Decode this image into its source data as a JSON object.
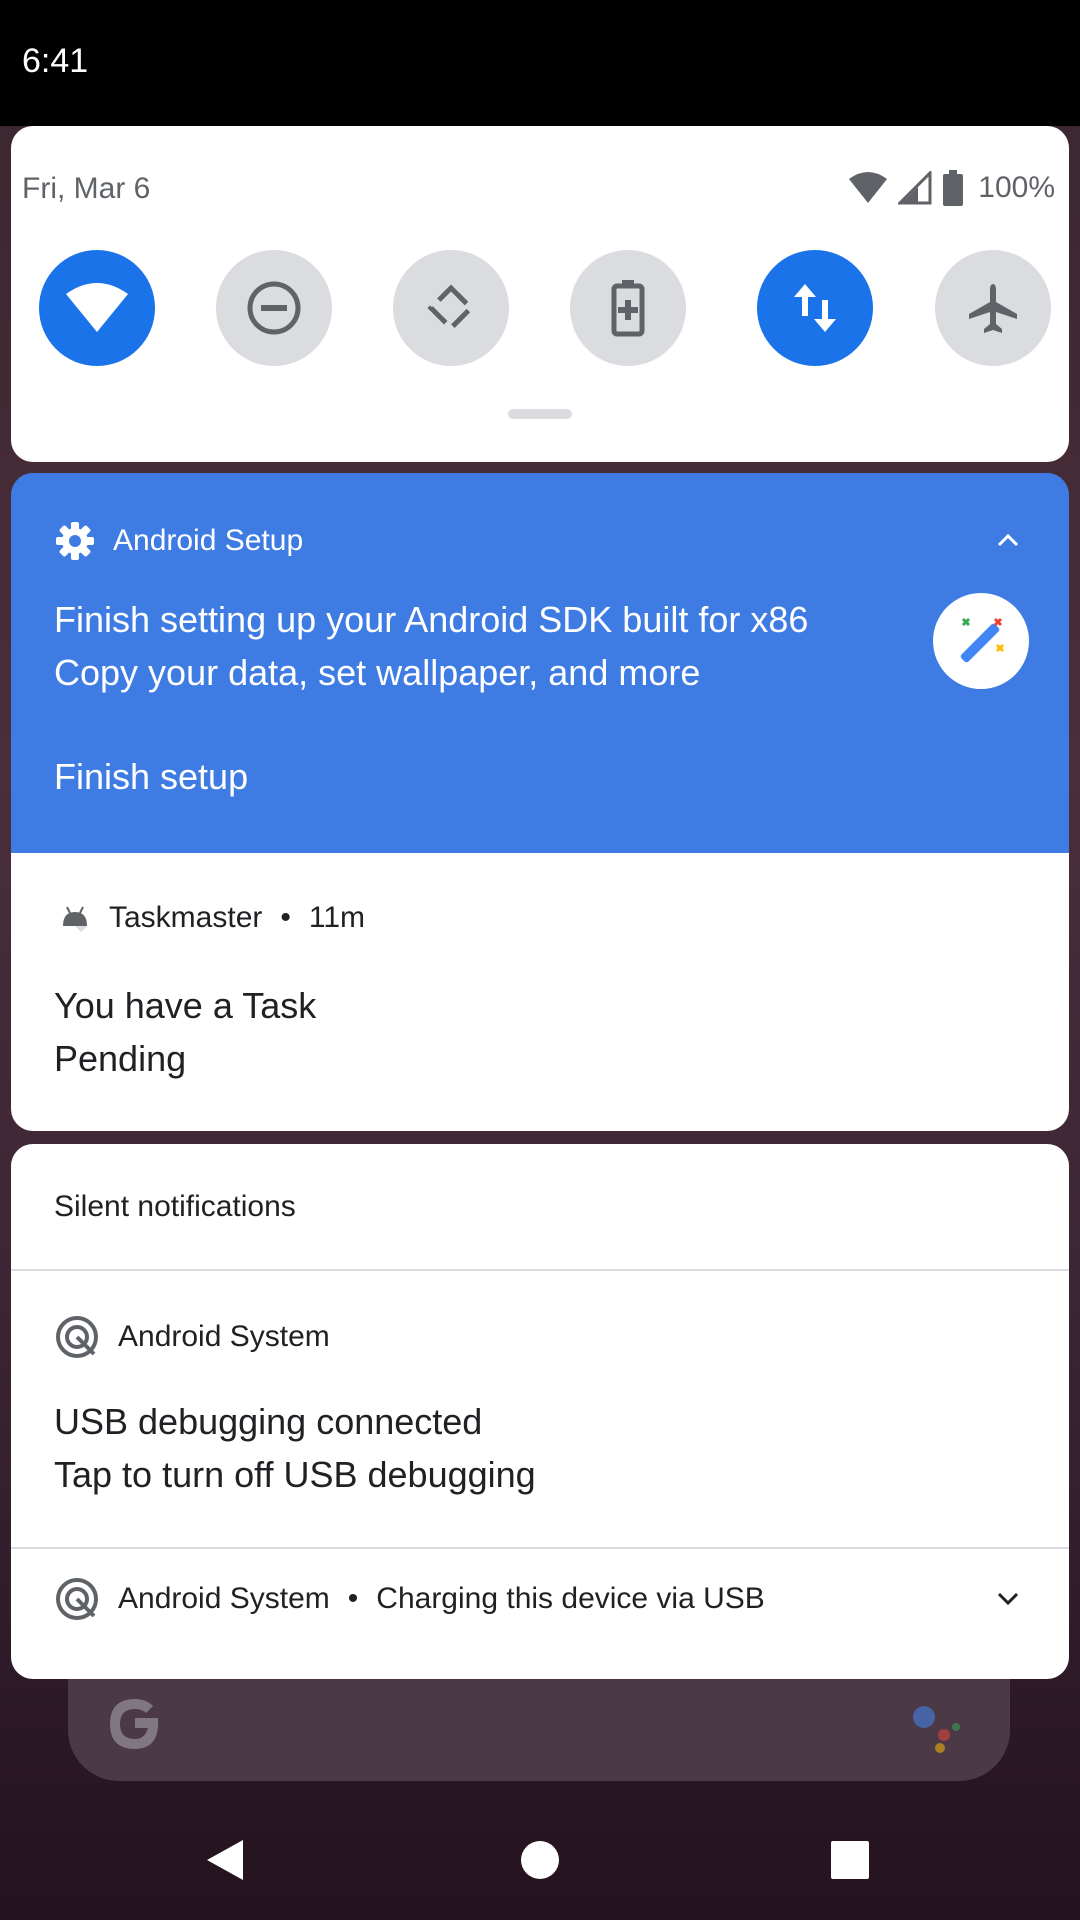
{
  "status_bar": {
    "time": "6:41"
  },
  "quick_settings": {
    "date": "Fri, Mar 6",
    "battery_percent": "100%",
    "tiles": [
      {
        "name": "wifi",
        "icon": "wifi-icon",
        "on": true
      },
      {
        "name": "do-not-disturb",
        "icon": "do-not-disturb-icon",
        "on": false
      },
      {
        "name": "auto-rotate",
        "icon": "auto-rotate-icon",
        "on": false
      },
      {
        "name": "battery-saver",
        "icon": "battery-saver-icon",
        "on": false
      },
      {
        "name": "mobile-data",
        "icon": "mobile-data-icon",
        "on": true
      },
      {
        "name": "airplane-mode",
        "icon": "airplane-icon",
        "on": false
      }
    ],
    "colors": {
      "tile_on": "#1a73e8",
      "tile_off": "#dadce0"
    }
  },
  "notifications": {
    "setup": {
      "app_name": "Android Setup",
      "title": "Finish setting up your Android SDK built for x86",
      "text": "Copy your data, set wallpaper, and more",
      "action": "Finish setup",
      "background": "#3e7ce4"
    },
    "taskmaster": {
      "app_name": "Taskmaster",
      "time": "11m",
      "line1": "You have a Task",
      "line2": "Pending"
    }
  },
  "silent": {
    "header": "Silent notifications",
    "usb": {
      "app_name": "Android System",
      "title": "USB debugging connected",
      "text": "Tap to turn off USB debugging"
    },
    "charging": {
      "app_name": "Android System",
      "text": "Charging this device via USB"
    }
  }
}
